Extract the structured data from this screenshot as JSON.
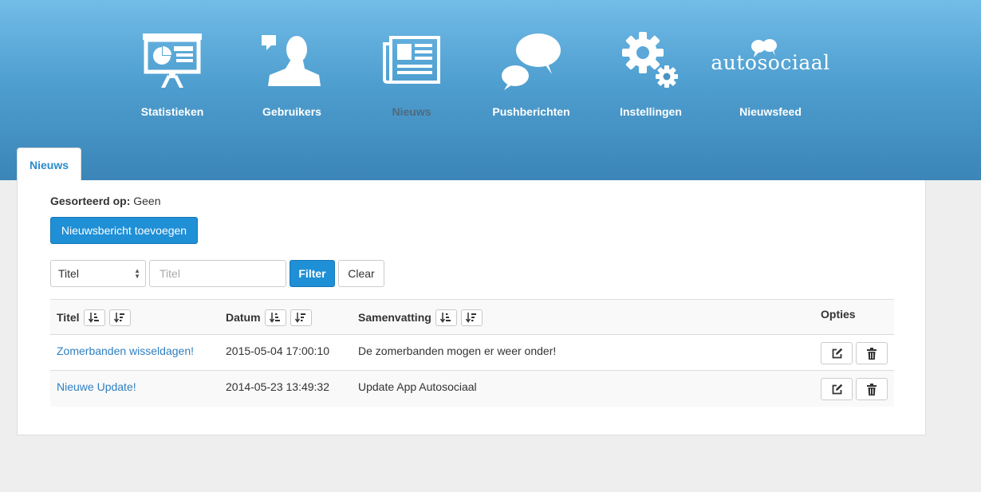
{
  "nav": [
    {
      "label": "Statistieken",
      "icon": "presentation-chart-icon",
      "active": false
    },
    {
      "label": "Gebruikers",
      "icon": "user-icon",
      "active": false
    },
    {
      "label": "Nieuws",
      "icon": "newspaper-icon",
      "active": true
    },
    {
      "label": "Pushberichten",
      "icon": "speech-bubbles-icon",
      "active": false
    },
    {
      "label": "Instellingen",
      "icon": "gears-icon",
      "active": false
    },
    {
      "label": "Nieuwsfeed",
      "icon": "autosociaal-logo",
      "active": false
    }
  ],
  "brand": {
    "logo_text": "autosociaal"
  },
  "tab": {
    "label": "Nieuws"
  },
  "sort": {
    "label": "Gesorteerd op:",
    "value": "Geen"
  },
  "add_button": {
    "label": "Nieuwsbericht toevoegen"
  },
  "filter": {
    "field_selected": "Titel",
    "placeholder": "Titel",
    "value": "",
    "filter_label": "Filter",
    "clear_label": "Clear"
  },
  "table": {
    "columns": {
      "title": "Titel",
      "date": "Datum",
      "summary": "Samenvatting",
      "options": "Opties"
    },
    "rows": [
      {
        "title": "Zomerbanden wisseldagen!",
        "date": "2015-05-04 17:00:10",
        "summary": "De zomerbanden mogen er weer onder!"
      },
      {
        "title": "Nieuwe Update!",
        "date": "2014-05-23 13:49:32",
        "summary": "Update App Autosociaal"
      }
    ]
  },
  "colors": {
    "header_top": "#72bce8",
    "header_bottom": "#3b85b7",
    "primary": "#1f8fd6",
    "link": "#2f7fc0",
    "active_nav": "#4e6a80"
  }
}
